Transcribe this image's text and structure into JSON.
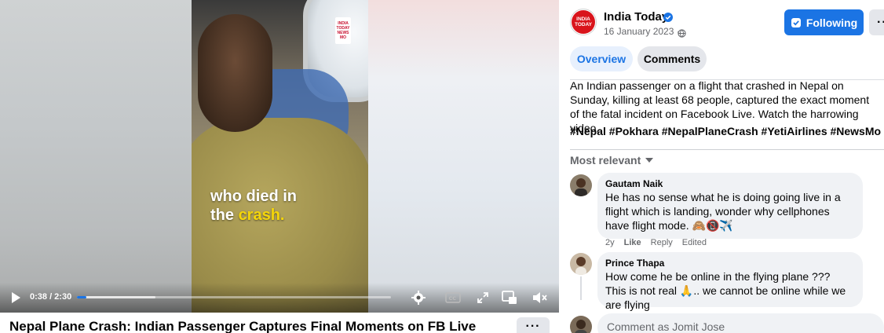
{
  "video": {
    "watermark": [
      "INDIA",
      "TODAY",
      "NEWS",
      "MO"
    ],
    "caption_line1": "who died in",
    "caption_line2_plain": "the ",
    "caption_line2_highlight": "crash.",
    "time": "0:38 / 2:30",
    "progress_played_fraction": 0.03,
    "progress_buffered_fraction": 0.25
  },
  "post": {
    "title": "Nepal Plane Crash: Indian Passenger Captures Final Moments on FB Live",
    "more_label": "···"
  },
  "page": {
    "name": "India Today",
    "avatar_text": [
      "INDIA",
      "TODAY"
    ],
    "date": "16 January 2023 ·",
    "follow_label": "Following",
    "more_label": "···"
  },
  "tabs": {
    "overview": "Overview",
    "comments": "Comments"
  },
  "description": "An Indian passenger on a flight that crashed in Nepal on Sunday, killing at least 68 people, captured the exact moment of the fatal incident on Facebook Live. Watch the harrowing video.",
  "hashtags": "#Nepal #Pokhara #NepalPlaneCrash #YetiAirlines #NewsMo",
  "sort_label": "Most relevant",
  "comments": [
    {
      "name": "Gautam Naik",
      "text": "He has no sense what he is doing going live in a flight which is landing, wonder why cellphones have flight mode. 🙈📵✈️",
      "age": "2y",
      "like": "Like",
      "reply": "Reply",
      "edited": "Edited"
    },
    {
      "name": "Prince Thapa",
      "text": "How come he be online in the flying plane ??? This is not real 🙏.. we cannot be online while we are flying"
    }
  ],
  "compose": {
    "placeholder": "Comment as Jomit Jose"
  },
  "colors": {
    "accent": "#1b74e4",
    "brand_red": "#d9141b",
    "caption_highlight": "#f5d60a"
  }
}
